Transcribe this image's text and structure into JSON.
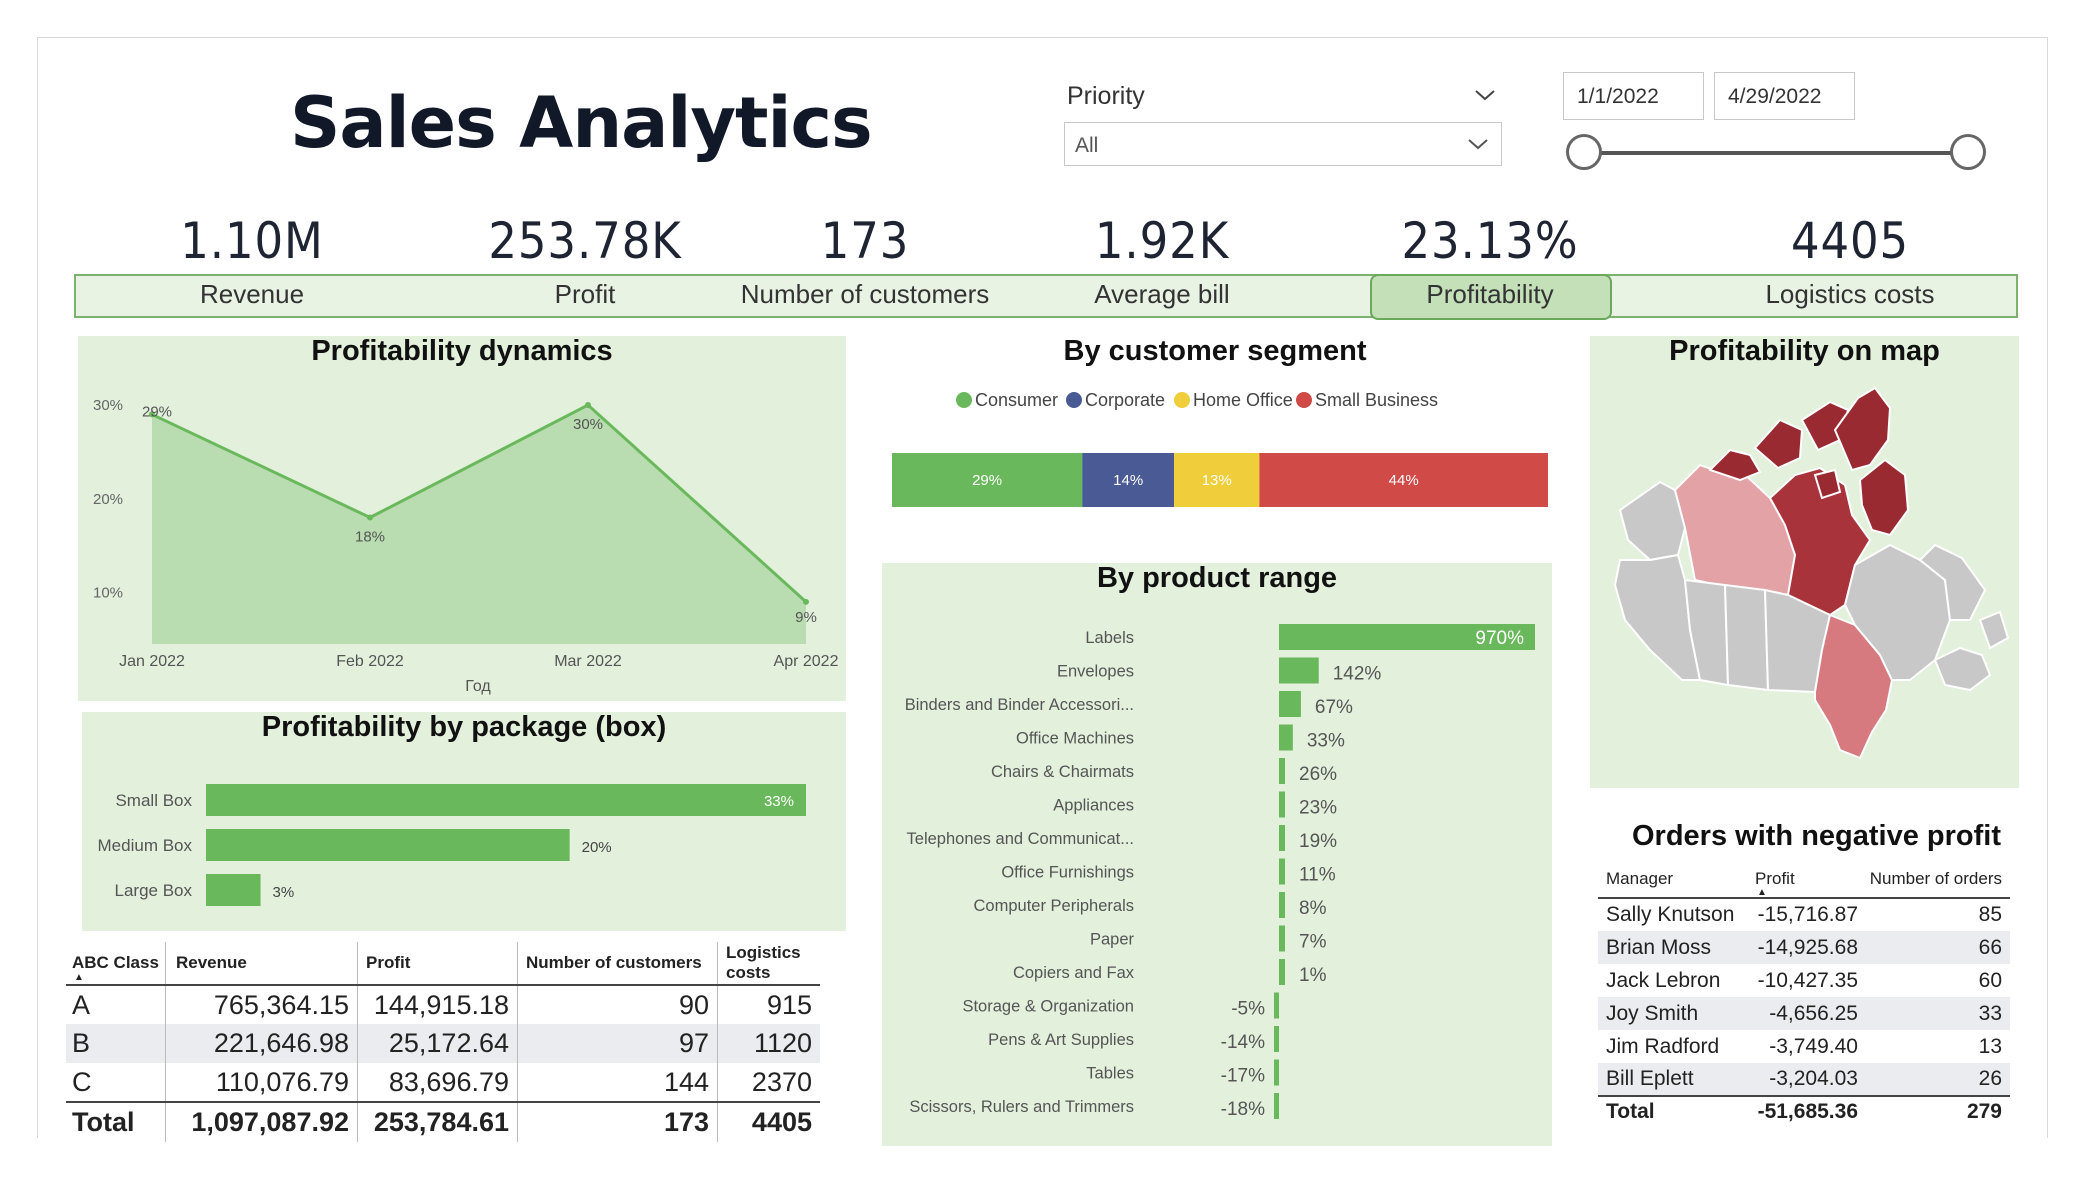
{
  "header": {
    "title": "Sales Analytics"
  },
  "filters": {
    "priority_label": "Priority",
    "priority_value": "All",
    "date_start": "1/1/2022",
    "date_end": "4/29/2022"
  },
  "kpis": [
    {
      "value": "1.10M",
      "label": "Revenue"
    },
    {
      "value": "253.78K",
      "label": "Profit"
    },
    {
      "value": "173",
      "label": "Number of customers"
    },
    {
      "value": "1.92K",
      "label": "Average bill"
    },
    {
      "value": "23.13%",
      "label": "Profitability",
      "selected": true
    },
    {
      "value": "4405",
      "label": "Logistics costs"
    }
  ],
  "colors": {
    "accent_green": "#6ab85c",
    "consumer": "#6ab85c",
    "corporate": "#4a5a94",
    "home_office": "#f0cd3a",
    "small_business": "#d04a47",
    "panel_bg": "#e2f0dc"
  },
  "chart_data": [
    {
      "type": "area",
      "title": "Profitability dynamics",
      "xlabel": "Год",
      "x": [
        "Jan 2022",
        "Feb 2022",
        "Mar 2022",
        "Apr 2022"
      ],
      "values": [
        29,
        18,
        30,
        9
      ],
      "data_labels": [
        "29%",
        "18%",
        "30%",
        "9%"
      ],
      "y_ticks": [
        "30%",
        "20%",
        "10%"
      ],
      "ylim": [
        4.5,
        31.5
      ]
    },
    {
      "type": "bar",
      "title": "Profitability by package (box)",
      "orientation": "horizontal",
      "categories": [
        "Small Box",
        "Medium Box",
        "Large Box"
      ],
      "values": [
        33,
        20,
        3
      ],
      "data_labels": [
        "33%",
        "20%",
        "3%"
      ]
    },
    {
      "type": "bar",
      "title": "By customer segment",
      "orientation": "stacked-100",
      "legend": [
        "Consumer",
        "Corporate",
        "Home Office",
        "Small Business"
      ],
      "values": [
        29,
        14,
        13,
        44
      ],
      "data_labels": [
        "29%",
        "14%",
        "13%",
        "44%"
      ]
    },
    {
      "type": "bar",
      "title": "By product range",
      "orientation": "horizontal",
      "categories": [
        "Labels",
        "Envelopes",
        "Binders and Binder Accessori...",
        "Office Machines",
        "Chairs & Chairmats",
        "Appliances",
        "Telephones and Communicat...",
        "Office Furnishings",
        "Computer Peripherals",
        "Paper",
        "Copiers and Fax",
        "Storage & Organization",
        "Pens & Art Supplies",
        "Tables",
        "Scissors, Rulers and Trimmers"
      ],
      "values": [
        970,
        142,
        67,
        33,
        26,
        23,
        19,
        11,
        8,
        7,
        1,
        -5,
        -14,
        -17,
        -18
      ],
      "data_labels": [
        "970%",
        "142%",
        "67%",
        "33%",
        "26%",
        "23%",
        "19%",
        "11%",
        "8%",
        "7%",
        "1%",
        "-5%",
        "-14%",
        "-17%",
        "-18%"
      ]
    }
  ],
  "map": {
    "title": "Profitability on map"
  },
  "abc_table": {
    "headers": [
      "ABC Class",
      "Revenue",
      "Profit",
      "Number of customers",
      "Logistics costs"
    ],
    "rows": [
      [
        "A",
        "765,364.15",
        "144,915.18",
        "90",
        "915"
      ],
      [
        "B",
        "221,646.98",
        "25,172.64",
        "97",
        "1120"
      ],
      [
        "C",
        "110,076.79",
        "83,696.79",
        "144",
        "2370"
      ]
    ],
    "total": [
      "Total",
      "1,097,087.92",
      "253,784.61",
      "173",
      "4405"
    ]
  },
  "neg_table": {
    "title": "Orders with negative profit",
    "headers": [
      "Manager",
      "Profit",
      "Number of orders"
    ],
    "rows": [
      [
        "Sally Knutson",
        "-15,716.87",
        "85"
      ],
      [
        "Brian Moss",
        "-14,925.68",
        "66"
      ],
      [
        "Jack Lebron",
        "-10,427.35",
        "60"
      ],
      [
        "Joy Smith",
        "-4,656.25",
        "33"
      ],
      [
        "Jim Radford",
        "-3,749.40",
        "13"
      ],
      [
        "Bill Eplett",
        "-3,204.03",
        "26"
      ]
    ],
    "total": [
      "Total",
      "-51,685.36",
      "279"
    ]
  }
}
